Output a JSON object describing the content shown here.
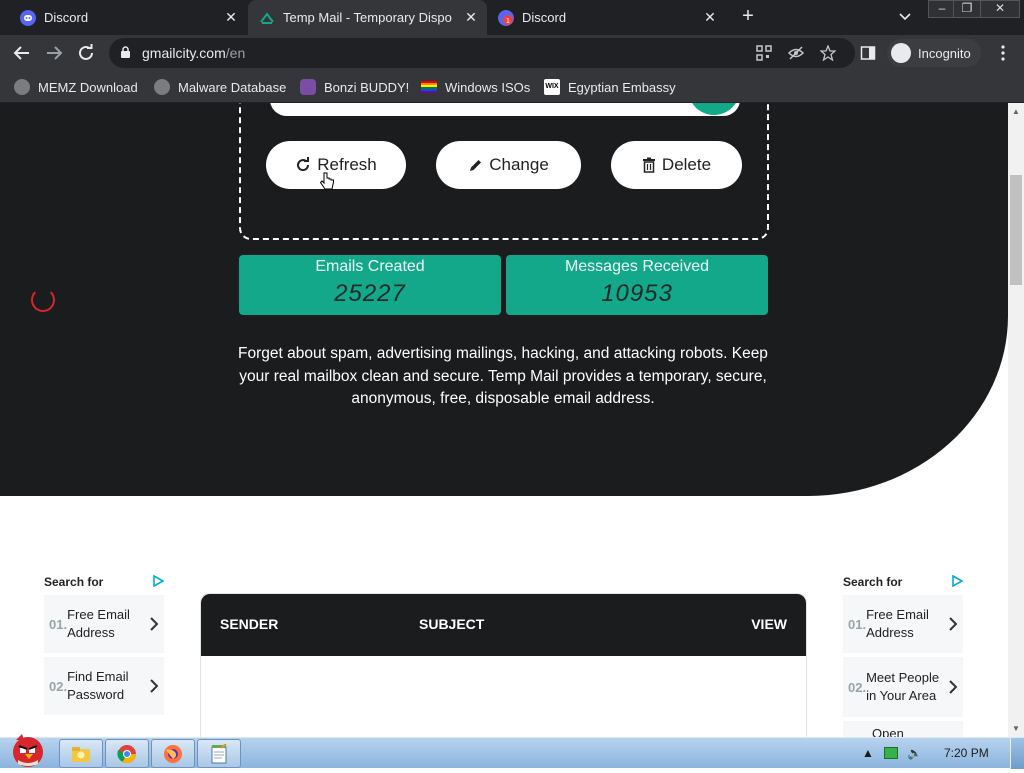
{
  "browser": {
    "tabs": [
      {
        "title": "Discord",
        "favicon": "discord-icon",
        "active": false
      },
      {
        "title": "Temp Mail - Temporary Dispo",
        "favicon": "tempmail-icon",
        "active": true
      },
      {
        "title": "Discord",
        "favicon": "discord-notification-icon",
        "active": false
      }
    ],
    "url": {
      "domain": "gmailcity.com",
      "path": "/en"
    },
    "profile_label": "Incognito",
    "bookmarks": [
      {
        "label": "MEMZ Download",
        "icon": "globe-icon"
      },
      {
        "label": "Malware Database",
        "icon": "globe-icon"
      },
      {
        "label": "Bonzi BUDDY!",
        "icon": "bonzi-icon"
      },
      {
        "label": "Windows ISOs",
        "icon": "rainbow-flag-icon"
      },
      {
        "label": "Egyptian Embassy",
        "icon": "wix-icon"
      }
    ]
  },
  "page": {
    "buttons": {
      "refresh": "Refresh",
      "change": "Change",
      "delete": "Delete"
    },
    "stats": [
      {
        "label": "Emails Created",
        "value": "25227"
      },
      {
        "label": "Messages Received",
        "value": "10953"
      }
    ],
    "description": "Forget about spam, advertising mailings, hacking, and attacking robots. Keep your real mailbox clean and secure. Temp Mail provides a temporary, secure, anonymous, free, disposable email address.",
    "ads": {
      "left": {
        "title": "Search for",
        "items": [
          {
            "num": "01.",
            "text": "Free Email Address"
          },
          {
            "num": "02.",
            "text": "Find Email Password"
          }
        ]
      },
      "right": {
        "title": "Search for",
        "items": [
          {
            "num": "01.",
            "text": "Free Email Address"
          },
          {
            "num": "02.",
            "text": "Meet People in Your Area"
          },
          {
            "num": "",
            "text": "Open"
          }
        ]
      }
    },
    "inbox_columns": {
      "sender": "SENDER",
      "subject": "SUBJECT",
      "view": "VIEW"
    }
  },
  "taskbar": {
    "clock": "7:20 PM"
  },
  "colors": {
    "accent": "#13a88a",
    "hero_bg": "#1b1c1e",
    "chrome_dark": "#202124"
  }
}
